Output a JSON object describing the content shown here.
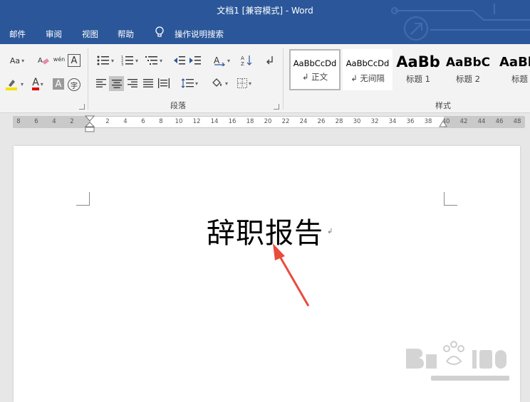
{
  "window": {
    "title": "文档1 [兼容模式] - Word"
  },
  "tabs": [
    {
      "label": "邮件"
    },
    {
      "label": "审阅"
    },
    {
      "label": "视图"
    },
    {
      "label": "帮助"
    },
    {
      "label": "操作说明搜索"
    }
  ],
  "ribbon": {
    "font": {
      "change_case_label": "Aa",
      "phonetic_label": "wén",
      "border_letter": "A",
      "shade_letter": "A",
      "enclose_char": "字",
      "font_color_letter": "A"
    },
    "paragraph": {
      "group_label": "段落"
    },
    "styles": {
      "group_label": "样式",
      "items": [
        {
          "sample": "AaBbCcDd",
          "name": "↲ 正文"
        },
        {
          "sample": "AaBbCcDd",
          "name": "↲ 无间隔"
        },
        {
          "sample": "AaBb",
          "name": "标题 1"
        },
        {
          "sample": "AaBbC",
          "name": "标题 2"
        },
        {
          "sample": "AaBb",
          "name": "标题"
        }
      ]
    }
  },
  "ruler": {
    "ticks": [
      "8",
      "6",
      "4",
      "2",
      "2",
      "4",
      "6",
      "8",
      "10",
      "12",
      "14",
      "16",
      "18",
      "20",
      "22",
      "24",
      "26",
      "28",
      "30",
      "32",
      "34",
      "36",
      "38",
      "40",
      "42",
      "44",
      "46",
      "48"
    ]
  },
  "document": {
    "text": "辞职报告",
    "paragraph_mark": "↲"
  },
  "colors": {
    "accent": "#2b579a",
    "arrow": "#e84c3d",
    "highlight": "#f5e100",
    "font_color": "#e00000"
  }
}
